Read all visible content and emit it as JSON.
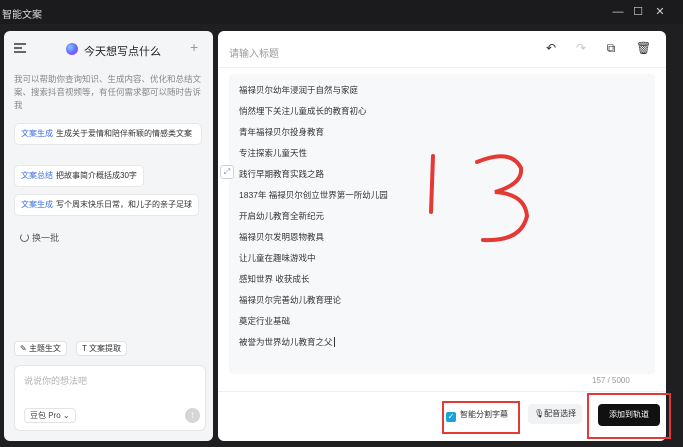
{
  "window": {
    "title": "智能文案",
    "minimize_glyph": "—",
    "maximize_glyph": "☐",
    "close_glyph": "✕"
  },
  "sidebar": {
    "heading": "今天想写点什么",
    "new_glyph": "+",
    "intro": "我可以帮助你查询知识、生成内容、优化和总结文案、搜索抖音视频等，有任何需求都可以随时告诉我",
    "suggestions": [
      {
        "tag": "文案生成",
        "text": "生成关于爱情和陪伴新颖的情感类文案"
      },
      {
        "tag": "文案总结",
        "text": "把故事简介概括成30字"
      },
      {
        "tag": "文案生成",
        "text": "写个周末快乐日常，和儿子的亲子足球"
      }
    ],
    "refresh_label": "换一批",
    "chips": [
      "主题生文",
      "文案提取"
    ],
    "input_placeholder": "说说你的想法吧",
    "model_label": "豆包 Pro",
    "send_glyph": "↑"
  },
  "editor": {
    "title_placeholder": "请输入标题",
    "tools": [
      "undo-icon",
      "redo-icon",
      "copy-icon",
      "delete-icon"
    ],
    "side_glyph": "⤢",
    "lines": [
      "福禄贝尔幼年浸润于自然与家庭",
      "悄然埋下关注儿童成长的教育初心",
      "青年福禄贝尔投身教育",
      "专注探索儿童天性",
      "践行早期教育实践之路",
      "1837年 福禄贝尔创立世界第一所幼儿园",
      "开启幼儿教育全新纪元",
      "福禄贝尔发明恩物教具",
      "让儿童在趣味游戏中",
      "感知世界 收获成长",
      "福禄贝尔完善幼儿教育理论",
      "奠定行业基础",
      "被誉为世界幼儿教育之父"
    ],
    "char_count": "157 / 5000"
  },
  "footer": {
    "smart_split_label": "智能分割字幕",
    "smart_split_checked": true,
    "voice_label": "配音选择",
    "add_track_label": "添加到轨道"
  },
  "annotation": {
    "handwritten_text": "13",
    "color": "#e53935"
  }
}
